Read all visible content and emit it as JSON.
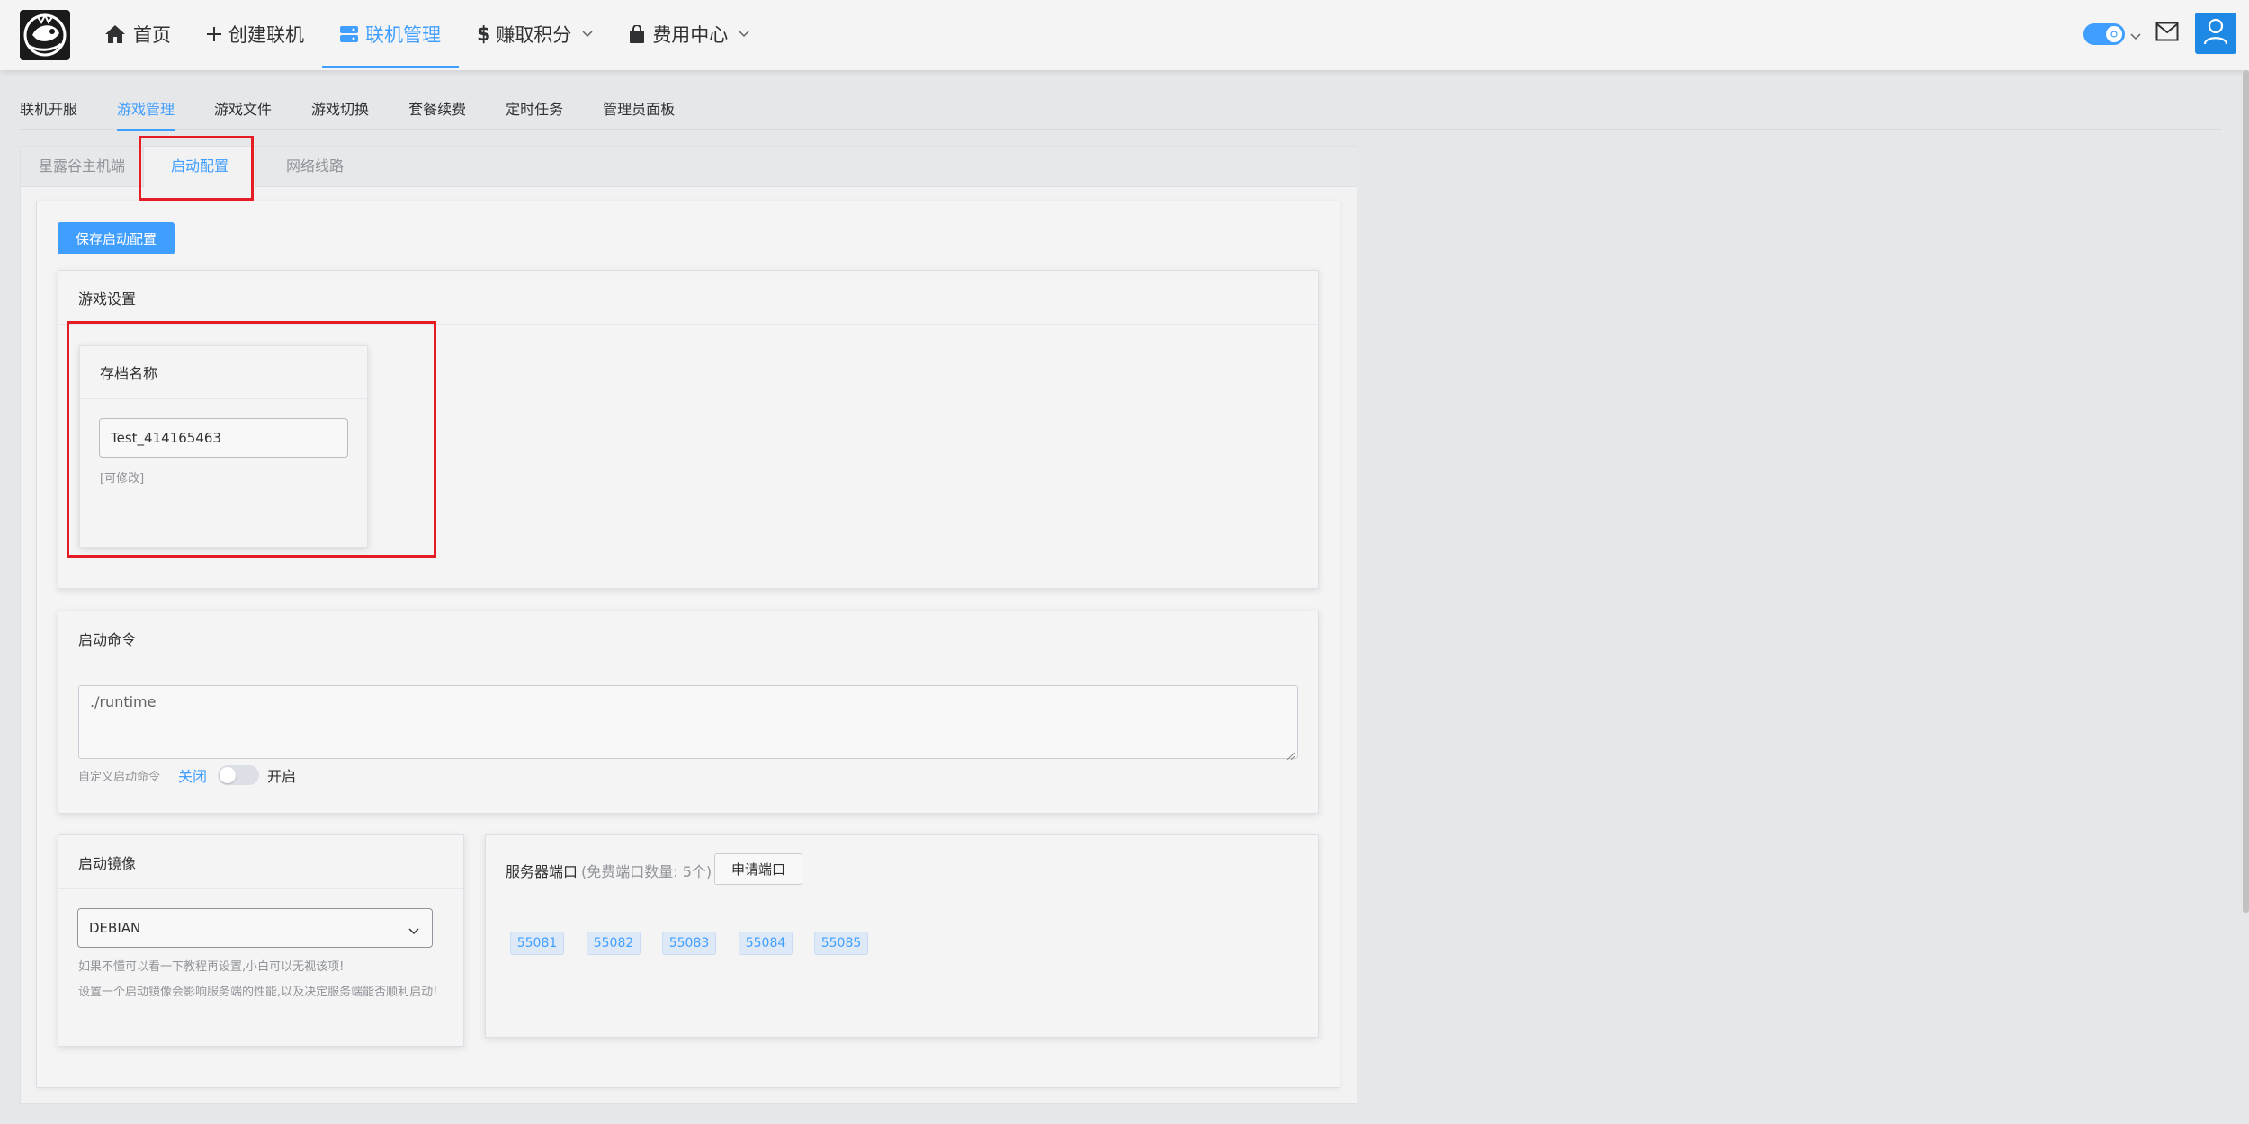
{
  "header": {
    "nav": [
      {
        "label": "首页",
        "icon": "home-icon"
      },
      {
        "label": "创建联机",
        "icon": "plus-icon"
      },
      {
        "label": "联机管理",
        "icon": "server-icon",
        "active": true
      },
      {
        "label": "赚取积分",
        "icon": "dollar-icon",
        "dropdown": true
      },
      {
        "label": "费用中心",
        "icon": "shopping-bag-icon",
        "dropdown": true
      }
    ],
    "right_icons": [
      "theme-toggle",
      "mail-icon",
      "user-icon"
    ]
  },
  "subtabs": [
    "联机开服",
    "游戏管理",
    "游戏文件",
    "游戏切换",
    "套餐续费",
    "定时任务",
    "管理员面板"
  ],
  "card_tabs": [
    "星露谷主机端",
    "启动配置",
    "网络线路"
  ],
  "save_button": "保存启动配置",
  "game_settings": {
    "title": "游戏设置",
    "save_name": {
      "title": "存档名称",
      "value": "Test_414165463",
      "hint": "[可修改]"
    }
  },
  "launch_command": {
    "title": "启动命令",
    "value": "./runtime",
    "custom_label": "自定义启动命令",
    "off_label": "关闭",
    "on_label": "开启",
    "enabled": false
  },
  "launch_image": {
    "title": "启动镜像",
    "selected": "DEBIAN",
    "hint1": "如果不懂可以看一下教程再设置,小白可以无视该项!",
    "hint2": "设置一个启动镜像会影响服务端的性能,以及决定服务端能否顺利启动!"
  },
  "server_ports": {
    "title": "服务器端口",
    "subtitle": "(免费端口数量: 5个)",
    "apply_button": "申请端口",
    "ports": [
      "55081",
      "55082",
      "55083",
      "55084",
      "55085"
    ]
  },
  "colors": {
    "accent": "#409eff",
    "highlight_box": "#e51c23",
    "user_button": "#1e88e5"
  }
}
